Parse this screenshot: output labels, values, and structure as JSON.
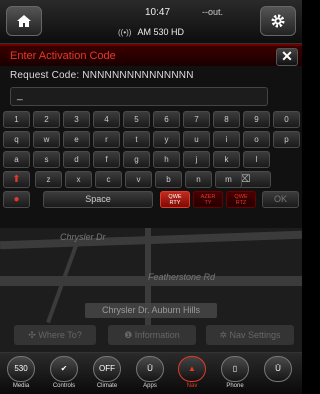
{
  "status": {
    "time": "10:47",
    "temperature": "--out.",
    "radio": "AM 530 HD"
  },
  "dialog": {
    "title": "Enter Activation Code",
    "request_label": "Request Code: NNNNNNNNNNNNNNN",
    "input_value": "_"
  },
  "keyboard": {
    "row1": [
      "1",
      "2",
      "3",
      "4",
      "5",
      "6",
      "7",
      "8",
      "9",
      "0"
    ],
    "row2": [
      "q",
      "w",
      "e",
      "r",
      "t",
      "y",
      "u",
      "i",
      "o",
      "p"
    ],
    "row3": [
      "a",
      "s",
      "d",
      "f",
      "g",
      "h",
      "j",
      "k",
      "l"
    ],
    "row4": [
      "z",
      "x",
      "c",
      "v",
      "b",
      "n",
      "m"
    ],
    "space_label": "Space",
    "ok_label": "OK",
    "lang_keys": [
      {
        "label": "QWE\nRTY",
        "active": true
      },
      {
        "label": "AZER\nTY",
        "active": false
      },
      {
        "label": "QWE\nRTZ",
        "active": false
      }
    ]
  },
  "map": {
    "street1": "Chrysler Dr",
    "street2": "Featherstone Rd",
    "location": "Chrysler Dr. Auburn Hills"
  },
  "nav_buttons": {
    "where_to": "Where To?",
    "information": "Information",
    "settings": "Nav Settings"
  },
  "dock": [
    {
      "id": "media",
      "label": "Media",
      "icon_text": "530"
    },
    {
      "id": "controls",
      "label": "Controls",
      "icon_text": "✔"
    },
    {
      "id": "climate",
      "label": "Climate",
      "icon_text": "OFF"
    },
    {
      "id": "apps",
      "label": "Apps",
      "icon_text": "Ū"
    },
    {
      "id": "nav",
      "label": "Nav",
      "icon_text": "▲"
    },
    {
      "id": "phone",
      "label": "Phone",
      "icon_text": "▯"
    },
    {
      "id": "more",
      "label": "",
      "icon_text": "Ū"
    }
  ]
}
